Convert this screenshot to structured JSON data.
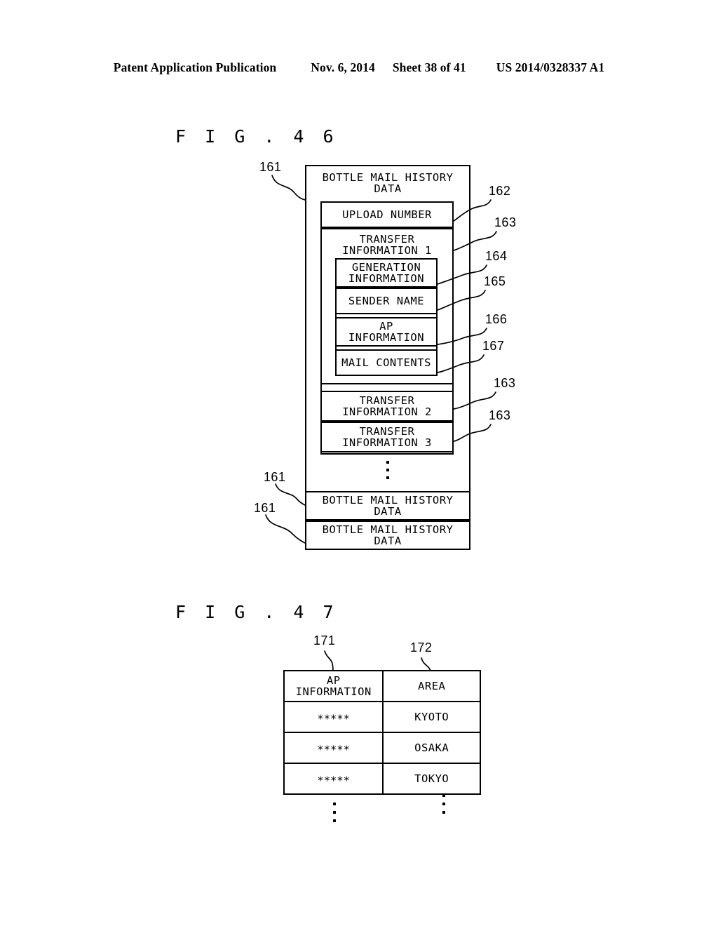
{
  "page_header": {
    "left": "Patent Application Publication",
    "date": "Nov. 6, 2014",
    "sheet": "Sheet 38 of 41",
    "patent_number": "US 2014/0328337 A1"
  },
  "figures": [
    {
      "title": "F I G .  4 6",
      "outer_label": "BOTTLE MAIL HISTORY\nDATA",
      "rows": {
        "upload_number": "UPLOAD NUMBER",
        "transfer_1": "TRANSFER\nINFORMATION 1",
        "generation_information": "GENERATION\nINFORMATION",
        "sender_name": "SENDER NAME",
        "ap_information": "AP\nINFORMATION",
        "mail_contents": "MAIL CONTENTS",
        "transfer_2": "TRANSFER\nINFORMATION 2",
        "transfer_3": "TRANSFER\nINFORMATION 3",
        "history_data_2": "BOTTLE MAIL HISTORY\nDATA",
        "history_data_3": "BOTTLE MAIL HISTORY\nDATA"
      },
      "refs": {
        "r161_top": "161",
        "r161_mid": "161",
        "r161_bottom": "161",
        "r162": "162",
        "r163_a": "163",
        "r164": "164",
        "r165": "165",
        "r166": "166",
        "r167": "167",
        "r163_b": "163",
        "r163_c": "163"
      }
    },
    {
      "title": "F I G .  4 7",
      "refs": {
        "r171": "171",
        "r172": "172"
      },
      "table": {
        "headers": [
          "AP\nINFORMATION",
          "AREA"
        ],
        "rows": [
          [
            "∗∗∗∗∗",
            "KYOTO"
          ],
          [
            "∗∗∗∗∗",
            "OSAKA"
          ],
          [
            "∗∗∗∗∗",
            "TOKYO"
          ]
        ]
      }
    }
  ],
  "colors": {
    "ink": "#000000",
    "paper": "#ffffff"
  }
}
